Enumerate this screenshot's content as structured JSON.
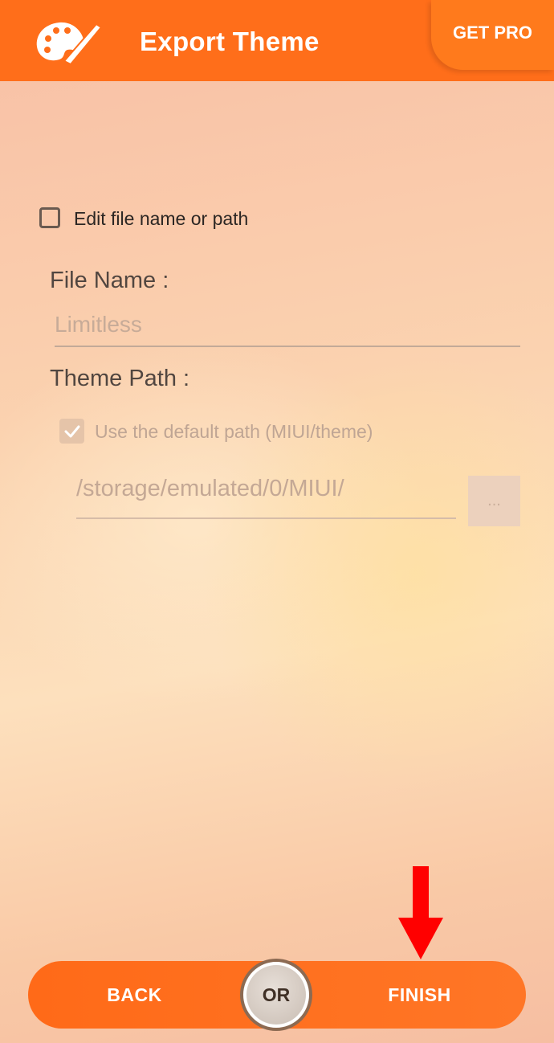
{
  "header": {
    "title": "Export Theme",
    "get_pro_label": "GET PRO",
    "logo_icon": "palette-icon"
  },
  "form": {
    "edit_checkbox_label": "Edit file name or path",
    "edit_checked": false,
    "file_name_label": "File Name :",
    "file_name_placeholder": "Limitless",
    "theme_path_label": "Theme Path :",
    "default_path_label": "Use the default path (MIUI/theme)",
    "default_path_checked": true,
    "path_value": "/storage/emulated/0/MIUI/",
    "browse_label": "..."
  },
  "footer": {
    "back_label": "BACK",
    "or_label": "OR",
    "finish_label": "FINISH"
  },
  "colors": {
    "header": "#ff6e1a",
    "annotation_arrow": "#ff0000"
  }
}
